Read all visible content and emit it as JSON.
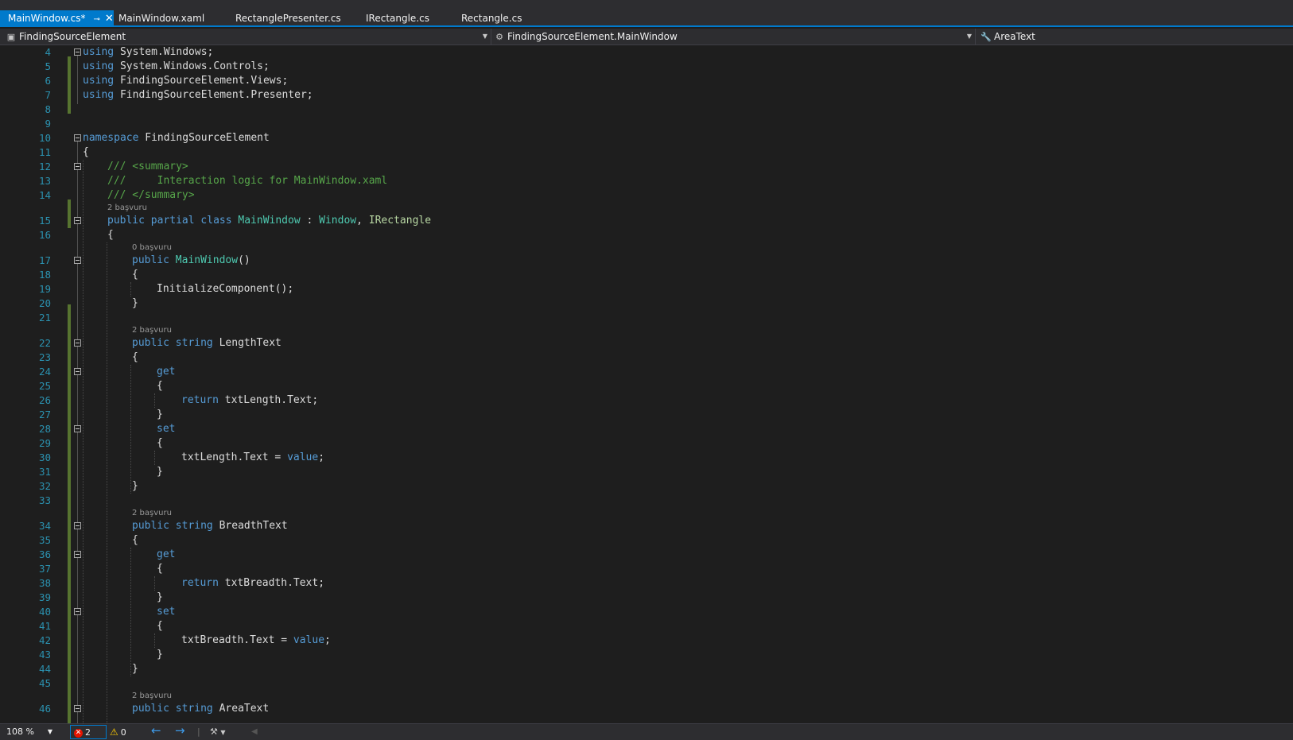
{
  "tabs": [
    {
      "label": "MainWindow.cs*",
      "active": true
    },
    {
      "label": "MainWindow.xaml",
      "active": false
    },
    {
      "label": "RectanglePresenter.cs",
      "active": false
    },
    {
      "label": "IRectangle.cs",
      "active": false
    },
    {
      "label": "Rectangle.cs",
      "active": false
    }
  ],
  "navbar": {
    "project": "FindingSourceElement",
    "type": "FindingSourceElement.MainWindow",
    "member": "AreaText"
  },
  "editor": {
    "line_numbers": [
      "4",
      "5",
      "6",
      "7",
      "8",
      "9",
      "10",
      "11",
      "12",
      "13",
      "14",
      "15",
      "16",
      "17",
      "18",
      "19",
      "20",
      "21",
      "22",
      "23",
      "24",
      "25",
      "26",
      "27",
      "28",
      "29",
      "30",
      "31",
      "32",
      "33",
      "34",
      "35",
      "36",
      "37",
      "38",
      "39",
      "40",
      "41",
      "42",
      "43",
      "44",
      "45",
      "46"
    ],
    "lines": {
      "l4": "System.Windows;",
      "l5": "System.Windows.Controls;",
      "l6": "FindingSourceElement.Views;",
      "l7": "FindingSourceElement.Presenter;",
      "l10": "FindingSourceElement",
      "l12": "/// <summary>",
      "l13": "///     Interaction logic for MainWindow.xaml",
      "l14": "/// </summary>",
      "l15_class": "MainWindow",
      "l15_base": "Window",
      "l15_iface": "IRectangle",
      "l17": "MainWindow",
      "l19": "InitializeComponent();",
      "l22": "LengthText",
      "l26": "txtLength.Text;",
      "l30": "txtLength.Text = ",
      "l34": "BreadthText",
      "l38": "txtBreadth.Text;",
      "l42": "txtBreadth.Text = ",
      "l46": "AreaText"
    },
    "keywords": {
      "using": "using",
      "namespace": "namespace",
      "public": "public",
      "partial": "partial",
      "class": "class",
      "string": "string",
      "get": "get",
      "set": "set",
      "return": "return",
      "value": "value"
    },
    "codelens": {
      "class_refs": "2 başvuru",
      "ctor_refs": "0 başvuru",
      "length_refs": "2 başvuru",
      "breadth_refs": "2 başvuru",
      "area_refs": "2 başvuru"
    }
  },
  "statusbar": {
    "zoom": "108 %",
    "errors": "2",
    "warnings": "0"
  }
}
